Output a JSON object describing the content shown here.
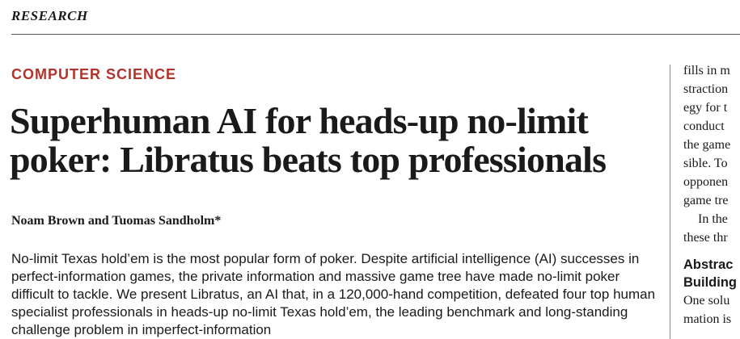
{
  "section": "RESEARCH",
  "category": "COMPUTER SCIENCE",
  "title": "Superhuman AI for heads-up no-limit poker: Libratus beats top professionals",
  "authors": "Noam Brown and Tuomas Sandholm*",
  "abstract": "No-limit Texas hold’em is the most popular form of poker. Despite artificial intelligence (AI) successes in perfect-information games, the private information and massive game tree have made no-limit poker difficult to tackle. We present Libratus, an AI that, in a 120,000-hand competition, defeated four top human specialist professionals in heads-up no-limit Texas hold’em, the leading benchmark and long-standing challenge problem in imperfect-information",
  "right_column": {
    "lines_a": [
      "fills in m",
      "straction",
      "egy for t",
      "conduct",
      "the game",
      "sible. To",
      "opponen",
      "game tre"
    ],
    "indent_line": "In the",
    "line_b": "these thr",
    "subheads": [
      "Abstrac",
      "Building"
    ],
    "lines_c": [
      "One solu",
      "mation is"
    ]
  }
}
